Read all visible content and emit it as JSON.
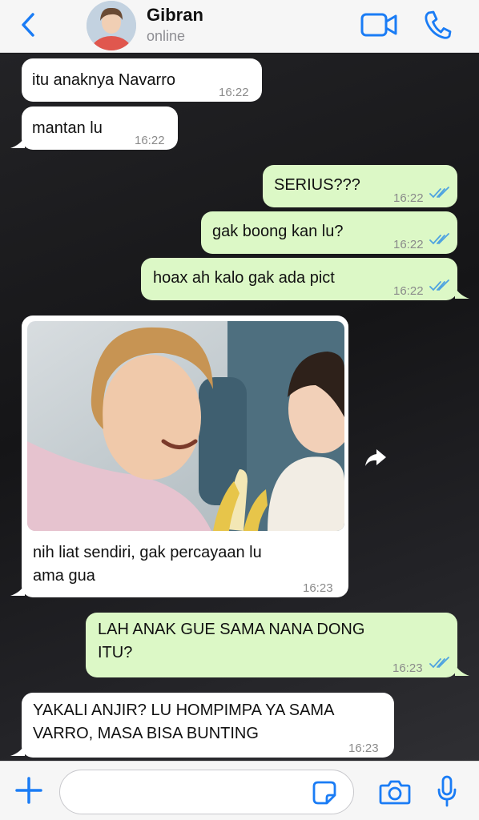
{
  "header": {
    "contact_name": "Gibran",
    "status": "online",
    "icons": [
      "chevron-left-icon",
      "video-camera-icon",
      "phone-icon"
    ]
  },
  "messages": [
    {
      "direction": "in",
      "text": "itu anaknya Navarro",
      "time": "16:22"
    },
    {
      "direction": "in",
      "text": "mantan lu",
      "time": "16:22"
    },
    {
      "direction": "out",
      "text": "SERIUS???",
      "time": "16:22",
      "read": true
    },
    {
      "direction": "out",
      "text": "gak boong kan lu?",
      "time": "16:22",
      "read": true
    },
    {
      "direction": "out",
      "text": "hoax ah kalo gak ada pict",
      "time": "16:22",
      "read": true
    },
    {
      "direction": "in",
      "type": "image",
      "caption_line1": "nih liat sendiri, gak percayaan lu",
      "caption_line2": "ama gua",
      "time": "16:23"
    },
    {
      "direction": "out",
      "text_line1": "LAH ANAK GUE SAMA NANA DONG",
      "text_line2": "ITU?",
      "time": "16:23",
      "read": true
    },
    {
      "direction": "in",
      "text_line1": "YAKALI ANJIR? LU HOMPIMPA YA SAMA",
      "text_line2": "VARRO, MASA BISA BUNTING",
      "time": "16:23"
    }
  ],
  "input": {
    "placeholder": "",
    "icons": [
      "plus-icon",
      "sticker-icon",
      "camera-icon",
      "microphone-icon"
    ]
  },
  "colors": {
    "accent": "#1a7cf5",
    "incoming_bubble": "#ffffff",
    "outgoing_bubble": "#dcf8c6",
    "read_ticks": "#4fa3e0"
  }
}
